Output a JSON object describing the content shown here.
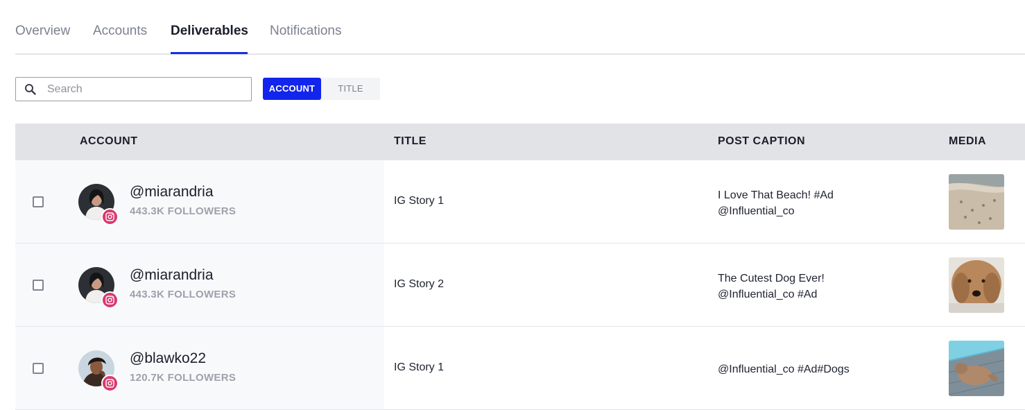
{
  "tabs": [
    {
      "label": "Overview",
      "active": false
    },
    {
      "label": "Accounts",
      "active": false
    },
    {
      "label": "Deliverables",
      "active": true
    },
    {
      "label": "Notifications",
      "active": false
    }
  ],
  "search": {
    "placeholder": "Search",
    "value": ""
  },
  "filter_toggle": {
    "selected": "ACCOUNT",
    "options": [
      "ACCOUNT",
      "TITLE"
    ]
  },
  "table": {
    "headers": {
      "account": "ACCOUNT",
      "title": "TITLE",
      "post_caption": "POST CAPTION",
      "media": "MEDIA"
    },
    "rows": [
      {
        "handle": "@miarandria",
        "followers": "443.3K FOLLOWERS",
        "platform_icon": "instagram-icon",
        "title": "IG Story 1",
        "caption_lines": [
          "I Love That Beach! #Ad",
          "@Influential_co"
        ],
        "media": "beach-sand-thumbnail"
      },
      {
        "handle": "@miarandria",
        "followers": "443.3K FOLLOWERS",
        "platform_icon": "instagram-icon",
        "title": "IG Story 2",
        "caption_lines": [
          "The Cutest Dog Ever!",
          "@Influential_co #Ad"
        ],
        "media": "doodle-dog-thumbnail"
      },
      {
        "handle": "@blawko22",
        "followers": "120.7K FOLLOWERS",
        "platform_icon": "instagram-icon",
        "title": "IG Story 1",
        "caption_lines": [
          "@Influential_co #Ad#Dogs"
        ],
        "media": "dog-on-deck-thumbnail"
      }
    ]
  },
  "colors": {
    "accent": "#1225ec",
    "tab_underline": "#1a2ee6",
    "instagram_badge": "#d93a6f",
    "header_bg": "#e2e3e7",
    "muted_text": "#9ea1ab"
  }
}
